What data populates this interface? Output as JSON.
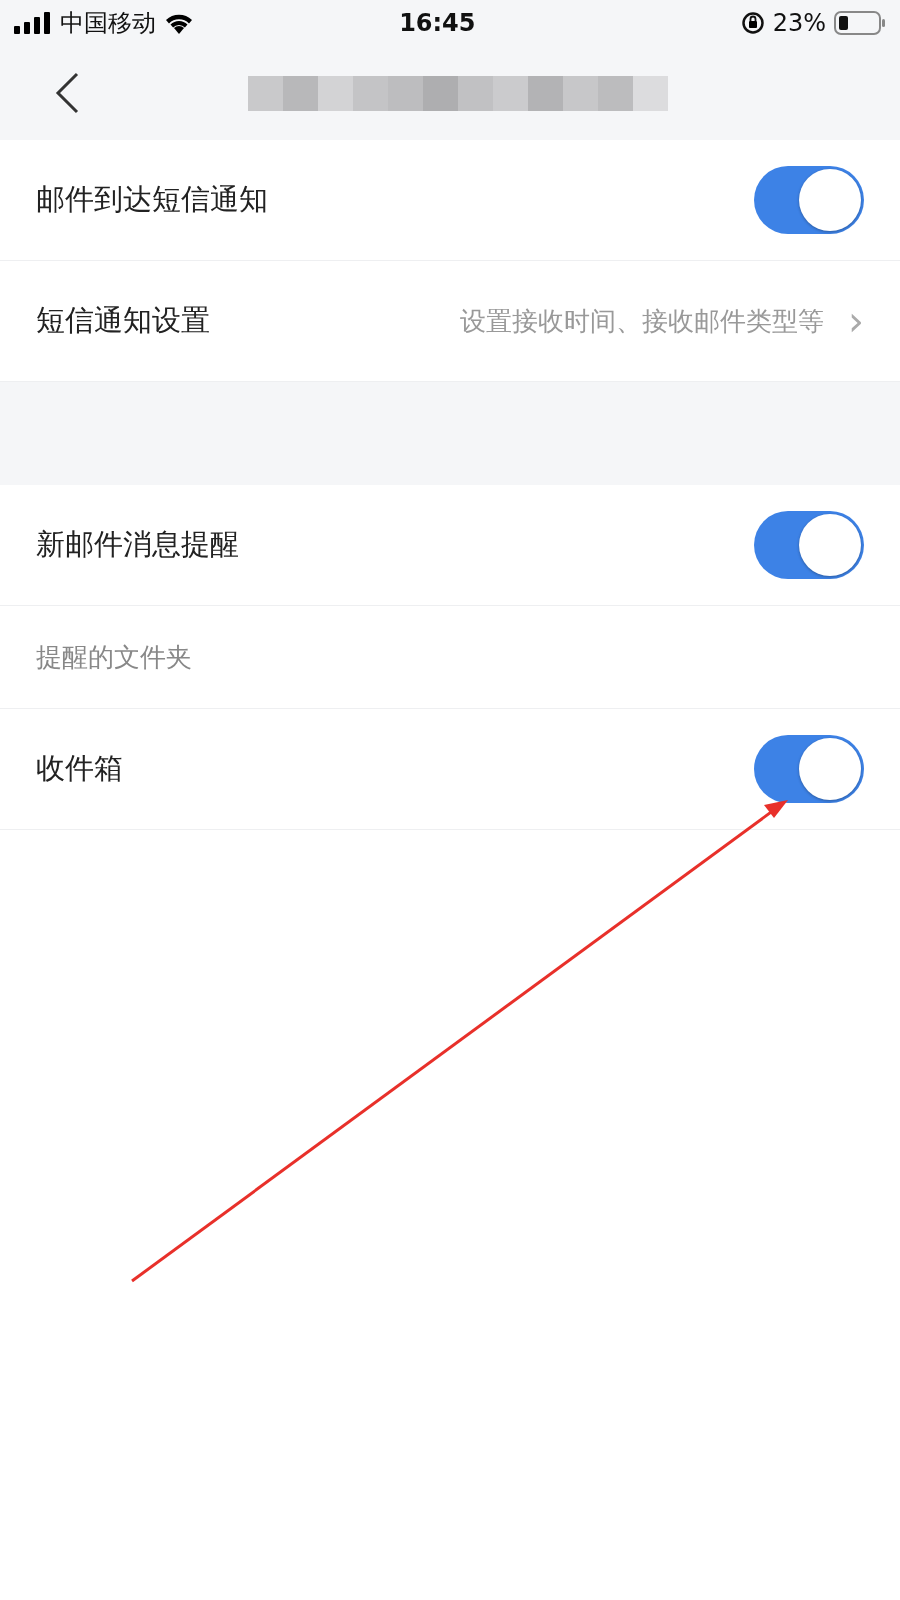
{
  "status_bar": {
    "carrier": "中国移动",
    "time": "16:45",
    "battery": "23%"
  },
  "settings": [
    {
      "kind": "toggle",
      "label": "邮件到达短信通知",
      "on": true
    },
    {
      "kind": "link",
      "label": "短信通知设置",
      "value": "设置接收时间、接收邮件类型等",
      "chevron": "›"
    },
    {
      "kind": "gap"
    },
    {
      "kind": "toggle",
      "label": "新邮件消息提醒",
      "on": true
    },
    {
      "kind": "section_label",
      "label": "提醒的文件夹"
    },
    {
      "kind": "toggle",
      "label": "收件箱",
      "on": true
    }
  ]
}
